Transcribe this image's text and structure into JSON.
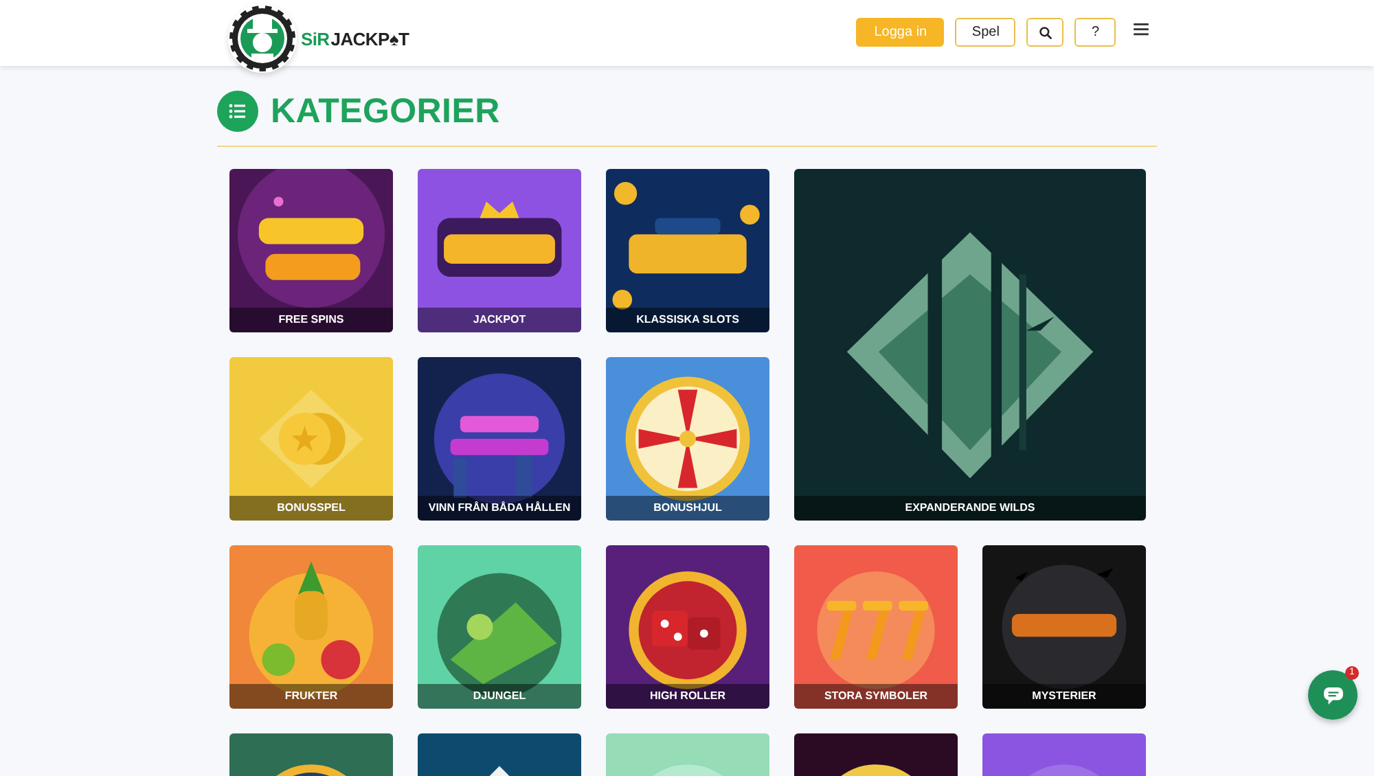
{
  "header": {
    "logo": {
      "prefix": "SiR",
      "name": "JACKP♠T"
    },
    "buttons": [
      {
        "kind": "login",
        "label": "Logga in"
      },
      {
        "kind": "outline",
        "label": "Spel"
      },
      {
        "kind": "search"
      },
      {
        "kind": "outline",
        "label": "?"
      },
      {
        "kind": "menu"
      }
    ]
  },
  "heading": "KATEGORIER",
  "tiles": [
    {
      "label": "FREE SPINS",
      "wide": false,
      "kind": "picture"
    },
    {
      "label": "JACKPOT",
      "wide": false,
      "kind": "picture"
    },
    {
      "label": "KLASSISKA SLOTS",
      "wide": false,
      "kind": "picture"
    },
    {
      "label": "BONUSSPEL",
      "wide": false,
      "kind": "picture"
    },
    {
      "label": "VINN FRÅN BÅDA HÅLLEN",
      "wide": false,
      "kind": "picture"
    },
    {
      "label": "BONUSHJUL",
      "wide": false,
      "kind": "picture"
    },
    {
      "label": "EXPANDERANDE WILDS",
      "wide": true,
      "kind": "picture"
    },
    {
      "label": "FRUKTER",
      "wide": false,
      "kind": "picture"
    },
    {
      "label": "DJUNGEL",
      "wide": false,
      "kind": "picture"
    },
    {
      "label": "HIGH ROLLER",
      "wide": false,
      "kind": "picture"
    },
    {
      "label": "STORA SYMBOLER",
      "wide": false,
      "kind": "picture"
    },
    {
      "label": "MYSTERIER",
      "wide": false,
      "kind": "picture"
    }
  ],
  "chat": {
    "badge": "1"
  }
}
